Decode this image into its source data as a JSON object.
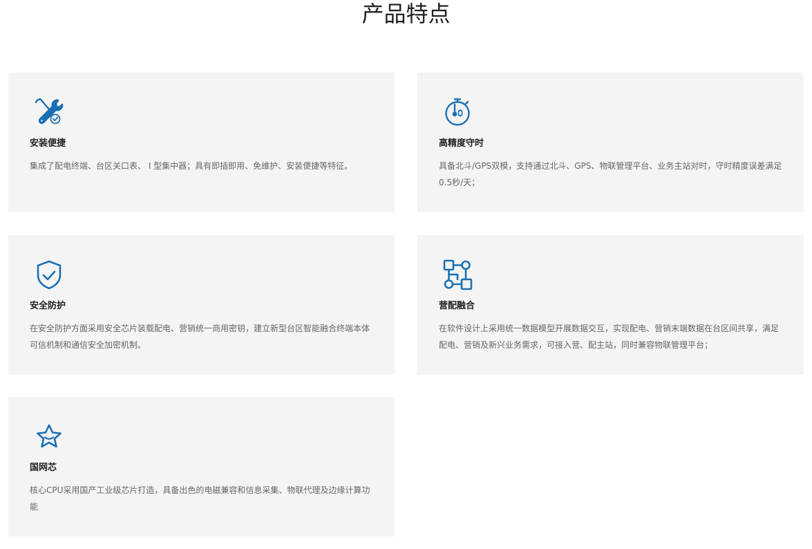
{
  "page": {
    "title": "产品特点"
  },
  "theme": {
    "icon_color": "#1a6fb4",
    "card_bg": "#f4f4f4",
    "title_color": "#222222",
    "desc_color": "#666666"
  },
  "features": [
    {
      "icon": "tools-icon",
      "title": "安装便捷",
      "desc": "集成了配电终端、台区关口表、 I 型集中器；具有即插即用、免维护、安装便捷等特征。"
    },
    {
      "icon": "stopwatch-icon",
      "title": "高精度守时",
      "desc": "具备北斗/GPS双模，支持通过北斗、GPS、物联管理平台、业务主站对时，守时精度误差满足0.5秒/天；"
    },
    {
      "icon": "shield-check-icon",
      "title": "安全防护",
      "desc": "在安全防护方面采用安全芯片装载配电、营销统一商用密钥，建立新型台区智能融合终端本体可信机制和通信安全加密机制。"
    },
    {
      "icon": "flow-nodes-icon",
      "title": "营配融合",
      "desc": "在软件设计上采用统一数据模型开展数据交互，实现配电、营销末端数据在台区间共享，满足配电、营销及新兴业务需求，可接入营、配主站，同时兼容物联管理平台；"
    },
    {
      "icon": "star-badge-icon",
      "title": "国网芯",
      "desc": "核心CPU采用国产工业级芯片打造，具备出色的电磁兼容和信息采集、物联代理及边缘计算功能"
    }
  ]
}
